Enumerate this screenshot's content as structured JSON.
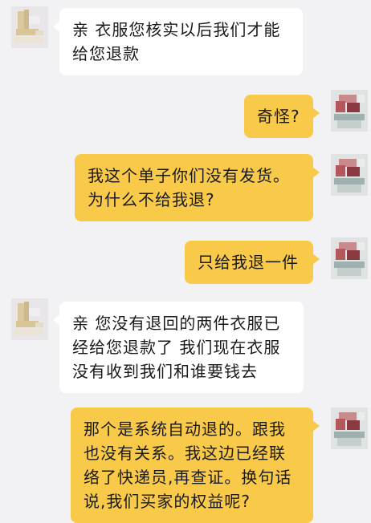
{
  "conversation": {
    "messages": [
      {
        "sender": "seller",
        "text": "亲 衣服您核实以后我们才能给您退款"
      },
      {
        "sender": "buyer",
        "text": "奇怪?"
      },
      {
        "sender": "buyer",
        "text": "我这个单子你们没有发货。为什么不给我退?"
      },
      {
        "sender": "buyer",
        "text": "只给我退一件"
      },
      {
        "sender": "seller",
        "text": "亲 您没有退回的两件衣服已经给您退款了 我们现在衣服没有收到我们和谁要钱去"
      },
      {
        "sender": "buyer",
        "text": "那个是系统自动退的。跟我也没有关系。我这边已经联络了快递员,再查证。换句话说,我们买家的权益呢?"
      }
    ]
  },
  "colors": {
    "background": "#f2f2f4",
    "incoming_bubble": "#ffffff",
    "outgoing_bubble": "#f9c94a",
    "text": "#1a1a1a"
  },
  "icons": {
    "seller_avatar": "pixelated-avatar-icon",
    "buyer_avatar": "pixelated-avatar-icon"
  }
}
